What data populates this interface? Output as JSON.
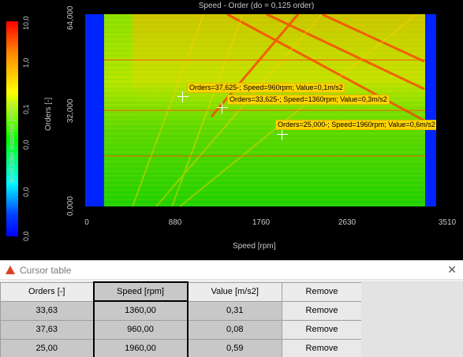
{
  "plot": {
    "title": "Speed - Order (do = 0,125 order)",
    "ylabel": "Orders [-]",
    "xlabel": "Speed [rpm]",
    "yticks": [
      "64,000",
      "32,000",
      "0,000"
    ],
    "xticks": [
      "0",
      "880",
      "1760",
      "2630",
      "3510"
    ],
    "colorbar": {
      "title": "acc/Order waterfall [m/s2]",
      "ticks": [
        "10,0",
        "1,0",
        "0,1",
        "0,0",
        "0,0",
        "0,0"
      ]
    },
    "cursor_labels": [
      "Orders=37,625-; Speed=960rpm; Value=0,1m/s2",
      "Orders=33,625-; Speed=1360rpm; Value=0,3m/s2",
      "Orders=25,000-; Speed=1960rpm; Value=0,6m/s2"
    ]
  },
  "cursor_table": {
    "title": "Cursor table",
    "close_symbol": "✕",
    "columns": [
      "Orders [-]",
      "Speed [rpm]",
      "Value [m/s2]",
      "Remove"
    ],
    "rows": [
      {
        "orders": "33,63",
        "speed": "1360,00",
        "value": "0,31",
        "remove": "Remove"
      },
      {
        "orders": "37,63",
        "speed": "960,00",
        "value": "0,08",
        "remove": "Remove"
      },
      {
        "orders": "25,00",
        "speed": "1960,00",
        "value": "0,59",
        "remove": "Remove"
      }
    ]
  },
  "colors": {
    "cursor_label_bg": "#ffd400",
    "side_band": "#0024ff",
    "window_icon": "#e04020"
  }
}
